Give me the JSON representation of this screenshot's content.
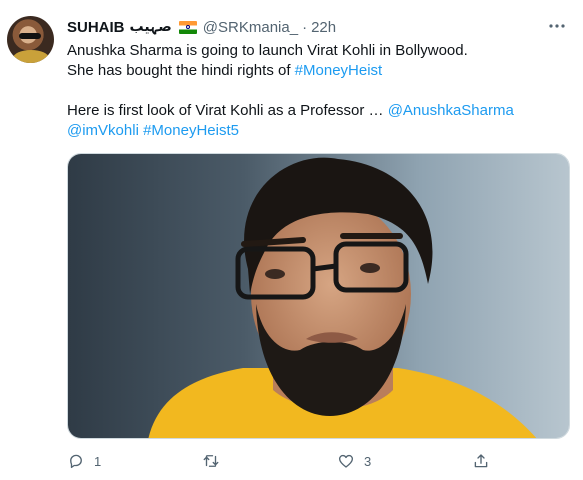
{
  "tweet": {
    "author": {
      "name": "SUHAIB",
      "name_suffix": "صہیب",
      "handle": "@SRKmania_",
      "separator": "·",
      "time": "22h"
    },
    "menu_icon": "more-icon",
    "text": {
      "line1": "Anushka Sharma is going to launch Virat Kohli in Bollywood.",
      "line2_prefix": "She has bought the hindi rights of ",
      "line2_tag": "#MoneyHeist",
      "line3_prefix": "Here is first look of Virat Kohli as a Professor … ",
      "line3_mention": "@AnushkaSharma",
      "line4_mention": "@imVkohli",
      "line4_space": " ",
      "line4_tag": "#MoneyHeist5"
    },
    "actions": {
      "reply_count": "1",
      "retweet_count": "",
      "like_count": "3",
      "icons": [
        "reply-icon",
        "retweet-icon",
        "like-icon",
        "share-icon"
      ]
    },
    "colors": {
      "link": "#1d9bf0",
      "secondary": "#536471",
      "text": "#0f1419"
    }
  }
}
